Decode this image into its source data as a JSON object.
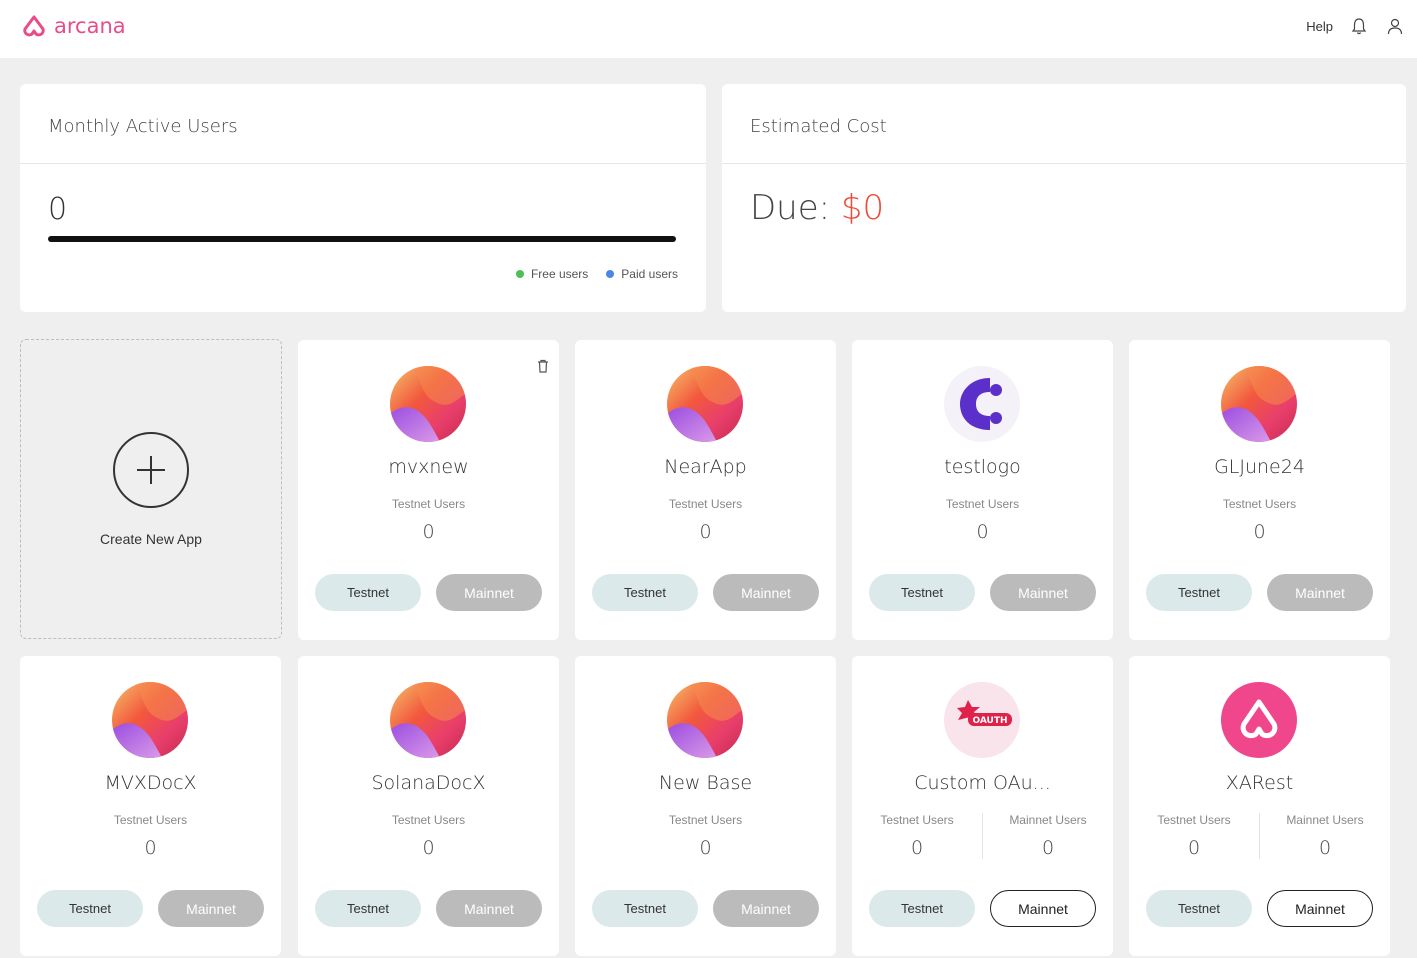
{
  "header": {
    "logo_text": "arcana",
    "brand_color": "#ea4c89",
    "help_label": "Help",
    "bell_icon": "bell-icon",
    "user_icon": "user-icon"
  },
  "mau": {
    "title": "Monthly Active Users",
    "value": "0",
    "free_fraction": 0,
    "legend": [
      {
        "label": "Free users",
        "color": "#4cbf58"
      },
      {
        "label": "Paid users",
        "color": "#4a86e8"
      }
    ]
  },
  "cost": {
    "title": "Estimated Cost",
    "due_label": "Due:",
    "due_amount": "$0",
    "amount_color": "#ef4a3b"
  },
  "create_app": {
    "label": "Create New App",
    "icon": "plus-icon"
  },
  "apps": [
    {
      "name": "mvxnew",
      "logo": "gradient",
      "users": [
        {
          "label": "Testnet Users",
          "value": "0"
        }
      ],
      "testnet_label": "Testnet",
      "mainnet_label": "Mainnet",
      "mainnet_active": false,
      "delete_icon": true
    },
    {
      "name": "NearApp",
      "logo": "gradient",
      "users": [
        {
          "label": "Testnet Users",
          "value": "0"
        }
      ],
      "testnet_label": "Testnet",
      "mainnet_label": "Mainnet",
      "mainnet_active": false
    },
    {
      "name": "testlogo",
      "logo": "c-logo",
      "users": [
        {
          "label": "Testnet Users",
          "value": "0"
        }
      ],
      "testnet_label": "Testnet",
      "mainnet_label": "Mainnet",
      "mainnet_active": false
    },
    {
      "name": "GLJune24",
      "logo": "gradient",
      "users": [
        {
          "label": "Testnet Users",
          "value": "0"
        }
      ],
      "testnet_label": "Testnet",
      "mainnet_label": "Mainnet",
      "mainnet_active": false
    },
    {
      "name": "MVXDocX",
      "logo": "gradient",
      "users": [
        {
          "label": "Testnet Users",
          "value": "0"
        }
      ],
      "testnet_label": "Testnet",
      "mainnet_label": "Mainnet",
      "mainnet_active": false
    },
    {
      "name": "SolanaDocX",
      "logo": "gradient",
      "users": [
        {
          "label": "Testnet Users",
          "value": "0"
        }
      ],
      "testnet_label": "Testnet",
      "mainnet_label": "Mainnet",
      "mainnet_active": false
    },
    {
      "name": "New Base",
      "logo": "gradient",
      "users": [
        {
          "label": "Testnet Users",
          "value": "0"
        }
      ],
      "testnet_label": "Testnet",
      "mainnet_label": "Mainnet",
      "mainnet_active": false
    },
    {
      "name": "Custom OAu...",
      "logo": "oauth",
      "logo_text": "OAUTH",
      "users": [
        {
          "label": "Testnet Users",
          "value": "0"
        },
        {
          "label": "Mainnet Users",
          "value": "0"
        }
      ],
      "testnet_label": "Testnet",
      "mainnet_label": "Mainnet",
      "mainnet_active": true
    },
    {
      "name": "XARest",
      "logo": "arcana",
      "users": [
        {
          "label": "Testnet Users",
          "value": "0"
        },
        {
          "label": "Mainnet Users",
          "value": "0"
        }
      ],
      "testnet_label": "Testnet",
      "mainnet_label": "Mainnet",
      "mainnet_active": true
    }
  ]
}
